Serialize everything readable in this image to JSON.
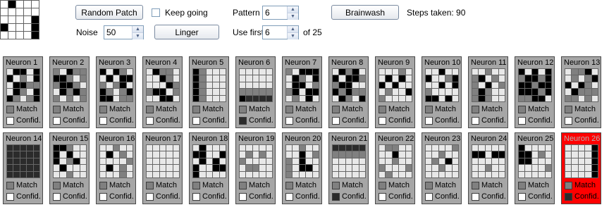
{
  "controls": {
    "random_patch_label": "Random Patch",
    "keep_going_label": "Keep going",
    "keep_going_checked": false,
    "pattern_label": "Pattern",
    "pattern_value": "6",
    "brainwash_label": "Brainwash",
    "steps_label": "Steps taken: 90",
    "noise_label": "Noise",
    "noise_value": "50",
    "linger_label": "Linger",
    "use_first_label": "Use first",
    "use_first_value": "6",
    "of_total_label": "of 25"
  },
  "preview_pattern": [
    0,
    1,
    0,
    0,
    0,
    0,
    0,
    0,
    0,
    0,
    0,
    0,
    0,
    0,
    1,
    1,
    0,
    0,
    0,
    1,
    0,
    0,
    0,
    0,
    1
  ],
  "colors": {
    "black": "#000000",
    "dark": "#2b2b2b",
    "mid": "#808080",
    "light": "#e8e8e8",
    "white": "#ffffff",
    "active_card": "#ff0000"
  },
  "neuron_labels": {
    "match": "Match",
    "confid": "Confid."
  },
  "neurons": [
    {
      "name": "Neuron 1",
      "match": "mid",
      "confid": "white",
      "cells": [
        "light",
        "black",
        "black",
        "light",
        "black",
        "black",
        "light",
        "mid",
        "light",
        "black",
        "light",
        "black",
        "black",
        "mid",
        "mid",
        "light",
        "black",
        "mid",
        "light",
        "black",
        "black",
        "mid",
        "light",
        "mid",
        "black"
      ]
    },
    {
      "name": "Neuron 2",
      "match": "mid",
      "confid": "white",
      "cells": [
        "mid",
        "light",
        "black",
        "mid",
        "mid",
        "black",
        "black",
        "mid",
        "light",
        "mid",
        "mid",
        "black",
        "black",
        "mid",
        "light",
        "light",
        "black",
        "mid",
        "black",
        "mid",
        "mid",
        "light",
        "mid",
        "light",
        "mid"
      ]
    },
    {
      "name": "Neuron 3",
      "match": "mid",
      "confid": "white",
      "cells": [
        "black",
        "light",
        "black",
        "mid",
        "light",
        "light",
        "black",
        "light",
        "black",
        "black",
        "mid",
        "light",
        "mid",
        "black",
        "light",
        "black",
        "mid",
        "light",
        "mid",
        "black",
        "black",
        "black",
        "light",
        "mid",
        "mid"
      ]
    },
    {
      "name": "Neuron 4",
      "match": "mid",
      "confid": "white",
      "cells": [
        "light",
        "black",
        "mid",
        "mid",
        "light",
        "light",
        "light",
        "black",
        "mid",
        "light",
        "light",
        "light",
        "light",
        "black",
        "mid",
        "mid",
        "black",
        "black",
        "light",
        "mid",
        "light",
        "light",
        "black",
        "black",
        "light"
      ]
    },
    {
      "name": "Neuron 5",
      "match": "mid",
      "confid": "white",
      "cells": [
        "black",
        "mid",
        "light",
        "light",
        "light",
        "black",
        "mid",
        "light",
        "light",
        "light",
        "black",
        "mid",
        "light",
        "light",
        "light",
        "black",
        "mid",
        "light",
        "light",
        "light",
        "black",
        "mid",
        "light",
        "light",
        "light"
      ]
    },
    {
      "name": "Neuron 6",
      "match": "mid",
      "confid": "dark",
      "cells": [
        "light",
        "light",
        "light",
        "light",
        "light",
        "light",
        "light",
        "light",
        "light",
        "light",
        "light",
        "light",
        "light",
        "light",
        "light",
        "mid",
        "mid",
        "mid",
        "mid",
        "mid",
        "black",
        "dark",
        "dark",
        "dark",
        "dark"
      ]
    },
    {
      "name": "Neuron 7",
      "match": "mid",
      "confid": "white",
      "cells": [
        "mid",
        "light",
        "black",
        "black",
        "black",
        "light",
        "black",
        "mid",
        "light",
        "black",
        "light",
        "black",
        "black",
        "light",
        "mid",
        "mid",
        "black",
        "light",
        "black",
        "black",
        "light",
        "mid",
        "light",
        "black",
        "light"
      ]
    },
    {
      "name": "Neuron 8",
      "match": "mid",
      "confid": "white",
      "cells": [
        "light",
        "black",
        "mid",
        "black",
        "light",
        "black",
        "light",
        "black",
        "black",
        "mid",
        "mid",
        "black",
        "black",
        "light",
        "light",
        "black",
        "mid",
        "black",
        "mid",
        "mid",
        "light",
        "black",
        "mid",
        "light",
        "black"
      ]
    },
    {
      "name": "Neuron 9",
      "match": "mid",
      "confid": "white",
      "cells": [
        "light",
        "light",
        "light",
        "mid",
        "light",
        "light",
        "black",
        "light",
        "black",
        "light",
        "black",
        "light",
        "black",
        "light",
        "light",
        "light",
        "mid",
        "light",
        "light",
        "black",
        "mid",
        "light",
        "light",
        "light",
        "light"
      ]
    },
    {
      "name": "Neuron 10",
      "match": "mid",
      "confid": "white",
      "cells": [
        "light",
        "light",
        "black",
        "light",
        "light",
        "black",
        "light",
        "light",
        "mid",
        "black",
        "light",
        "light",
        "black",
        "light",
        "black",
        "mid",
        "light",
        "light",
        "light",
        "light",
        "black",
        "black",
        "light",
        "black",
        "light"
      ]
    },
    {
      "name": "Neuron 11",
      "match": "mid",
      "confid": "white",
      "cells": [
        "light",
        "light",
        "mid",
        "light",
        "light",
        "mid",
        "black",
        "light",
        "mid",
        "light",
        "mid",
        "light",
        "black",
        "light",
        "mid",
        "mid",
        "black",
        "mid",
        "light",
        "light",
        "mid",
        "black",
        "mid",
        "light",
        "light"
      ]
    },
    {
      "name": "Neuron 12",
      "match": "mid",
      "confid": "white",
      "cells": [
        "black",
        "light",
        "black",
        "light",
        "black",
        "mid",
        "black",
        "black",
        "mid",
        "black",
        "black",
        "black",
        "mid",
        "black",
        "black",
        "black",
        "black",
        "black",
        "mid",
        "black",
        "mid",
        "mid",
        "black",
        "black",
        "light"
      ]
    },
    {
      "name": "Neuron 13",
      "match": "mid",
      "confid": "white",
      "cells": [
        "light",
        "mid",
        "mid",
        "black",
        "light",
        "light",
        "mid",
        "light",
        "mid",
        "black",
        "black",
        "light",
        "black",
        "mid",
        "light",
        "light",
        "black",
        "mid",
        "mid",
        "mid",
        "mid",
        "mid",
        "light",
        "mid",
        "light"
      ]
    },
    {
      "name": "Neuron 14",
      "match": "mid",
      "confid": "white",
      "cells": [
        "dark",
        "dark",
        "dark",
        "dark",
        "dark",
        "dark",
        "dark",
        "dark",
        "dark",
        "dark",
        "dark",
        "dark",
        "dark",
        "dark",
        "dark",
        "dark",
        "dark",
        "dark",
        "dark",
        "dark",
        "dark",
        "dark",
        "dark",
        "dark",
        "dark"
      ]
    },
    {
      "name": "Neuron 15",
      "match": "mid",
      "confid": "white",
      "cells": [
        "black",
        "black",
        "mid",
        "light",
        "light",
        "black",
        "light",
        "black",
        "light",
        "light",
        "black",
        "light",
        "mid",
        "black",
        "light",
        "light",
        "black",
        "light",
        "light",
        "light",
        "light",
        "light",
        "mid",
        "light",
        "light"
      ]
    },
    {
      "name": "Neuron 16",
      "match": "mid",
      "confid": "white",
      "cells": [
        "light",
        "light",
        "mid",
        "light",
        "light",
        "light",
        "black",
        "light",
        "mid",
        "light",
        "light",
        "light",
        "light",
        "light",
        "mid",
        "light",
        "black",
        "light",
        "mid",
        "light",
        "light",
        "light",
        "light",
        "mid",
        "light"
      ]
    },
    {
      "name": "Neuron 17",
      "match": "mid",
      "confid": "white",
      "cells": [
        "light",
        "light",
        "light",
        "light",
        "light",
        "light",
        "light",
        "light",
        "light",
        "light",
        "light",
        "light",
        "light",
        "light",
        "light",
        "light",
        "light",
        "light",
        "light",
        "light",
        "light",
        "light",
        "light",
        "light",
        "light"
      ]
    },
    {
      "name": "Neuron 18",
      "match": "mid",
      "confid": "white",
      "cells": [
        "light",
        "black",
        "light",
        "light",
        "light",
        "black",
        "black",
        "light",
        "light",
        "black",
        "light",
        "black",
        "light",
        "black",
        "light",
        "black",
        "light",
        "light",
        "black",
        "black",
        "black",
        "light",
        "light",
        "light",
        "light"
      ]
    },
    {
      "name": "Neuron 19",
      "match": "mid",
      "confid": "white",
      "cells": [
        "light",
        "light",
        "light",
        "light",
        "light",
        "light",
        "mid",
        "light",
        "mid",
        "light",
        "mid",
        "light",
        "light",
        "light",
        "light",
        "light",
        "mid",
        "mid",
        "light",
        "light",
        "light",
        "light",
        "light",
        "light",
        "light"
      ]
    },
    {
      "name": "Neuron 20",
      "match": "mid",
      "confid": "white",
      "cells": [
        "light",
        "light",
        "mid",
        "light",
        "light",
        "light",
        "light",
        "black",
        "light",
        "mid",
        "mid",
        "light",
        "black",
        "light",
        "light",
        "mid",
        "light",
        "black",
        "black",
        "light",
        "mid",
        "light",
        "light",
        "light",
        "light"
      ]
    },
    {
      "name": "Neuron 21",
      "match": "mid",
      "confid": "dark",
      "cells": [
        "dark",
        "dark",
        "dark",
        "dark",
        "dark",
        "mid",
        "mid",
        "mid",
        "mid",
        "mid",
        "light",
        "light",
        "light",
        "light",
        "light",
        "light",
        "light",
        "light",
        "light",
        "light",
        "light",
        "light",
        "light",
        "light",
        "light"
      ]
    },
    {
      "name": "Neuron 22",
      "match": "mid",
      "confid": "white",
      "cells": [
        "light",
        "mid",
        "mid",
        "light",
        "light",
        "light",
        "light",
        "black",
        "light",
        "light",
        "light",
        "light",
        "mid",
        "light",
        "light",
        "mid",
        "light",
        "light",
        "light",
        "mid",
        "light",
        "mid",
        "light",
        "light",
        "light"
      ]
    },
    {
      "name": "Neuron 23",
      "match": "mid",
      "confid": "white",
      "cells": [
        "light",
        "light",
        "light",
        "light",
        "mid",
        "light",
        "light",
        "mid",
        "light",
        "light",
        "light",
        "mid",
        "light",
        "black",
        "light",
        "light",
        "light",
        "mid",
        "light",
        "light",
        "light",
        "light",
        "light",
        "light",
        "light"
      ]
    },
    {
      "name": "Neuron 24",
      "match": "mid",
      "confid": "white",
      "cells": [
        "light",
        "light",
        "light",
        "light",
        "light",
        "black",
        "black",
        "light",
        "black",
        "black",
        "light",
        "light",
        "light",
        "light",
        "light",
        "light",
        "light",
        "mid",
        "light",
        "light",
        "light",
        "light",
        "light",
        "light",
        "light"
      ]
    },
    {
      "name": "Neuron 25",
      "match": "mid",
      "confid": "white",
      "cells": [
        "black",
        "light",
        "light",
        "light",
        "light",
        "black",
        "black",
        "light",
        "mid",
        "light",
        "black",
        "black",
        "light",
        "light",
        "light",
        "light",
        "light",
        "light",
        "light",
        "mid",
        "light",
        "light",
        "light",
        "light",
        "light"
      ]
    },
    {
      "name": "Neuron 26",
      "match": "mid",
      "confid": "dark",
      "active": true,
      "cells": [
        "light",
        "light",
        "light",
        "light",
        "black",
        "light",
        "light",
        "light",
        "light",
        "black",
        "light",
        "light",
        "light",
        "light",
        "black",
        "light",
        "light",
        "light",
        "light",
        "black",
        "light",
        "light",
        "light",
        "light",
        "black"
      ]
    }
  ]
}
